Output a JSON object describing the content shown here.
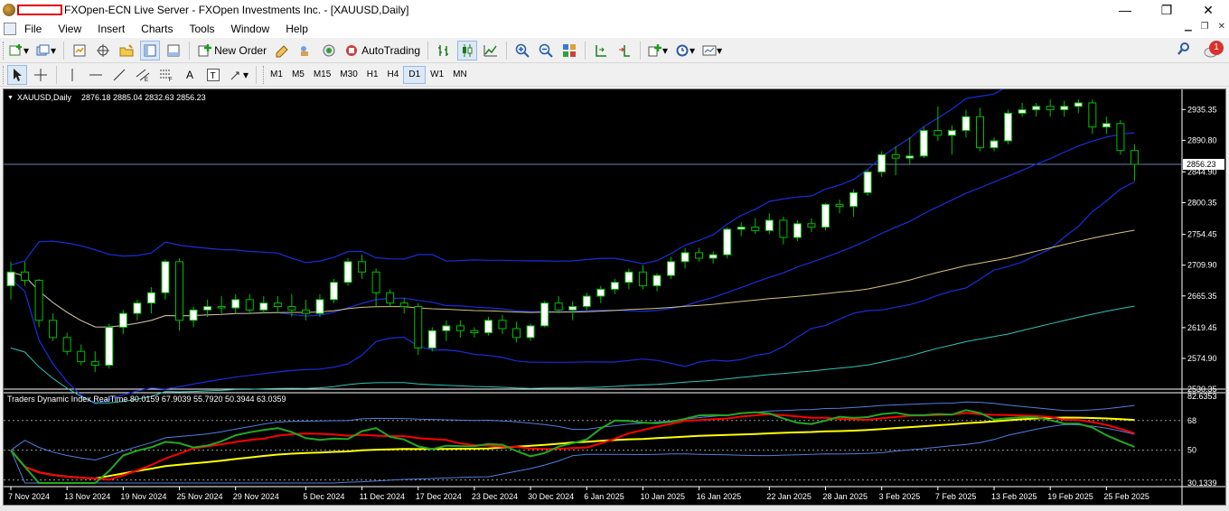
{
  "window": {
    "title": "FXOpen-ECN Live Server - FXOpen Investments Inc. - [XAUUSD,Daily]",
    "controls": {
      "minimize": "—",
      "maximize": "❐",
      "close": "✕"
    }
  },
  "menu": [
    "File",
    "Edit",
    "View",
    "Insert",
    "Charts",
    "Tools",
    "Window",
    "Help"
  ],
  "menu_visible": [
    "File",
    "View",
    "Insert",
    "Charts",
    "Tools",
    "Window",
    "Help"
  ],
  "toolbar": {
    "new_order": "New Order",
    "autotrading": "AutoTrading",
    "notifications_count": "1"
  },
  "timeframes": [
    "M1",
    "M5",
    "M15",
    "M30",
    "H1",
    "H4",
    "D1",
    "W1",
    "MN"
  ],
  "selected_timeframe": "D1",
  "chart": {
    "symbol_label": "XAUUSD,Daily",
    "ohlc_label": "2876.18 2885.04 2832.63 2856.23",
    "current_price_label": "2856.23",
    "price_ticks": [
      "2935.35",
      "2890.80",
      "2844.90",
      "2800.35",
      "2754.45",
      "2709.90",
      "2665.35",
      "2619.45",
      "2574.90",
      "2530.35"
    ],
    "indicator_label": "Traders Dynamic Index RealTime 80.0159 67.9039 55.7920 50.3944 63.0359",
    "indicator_ticks": [
      "82.6353",
      "68",
      "50",
      "30.1339"
    ],
    "date_ticks": [
      "7 Nov 2024",
      "13 Nov 2024",
      "19 Nov 2024",
      "25 Nov 2024",
      "29 Nov 2024",
      "5 Dec 2024",
      "11 Dec 2024",
      "17 Dec 2024",
      "23 Dec 2024",
      "30 Dec 2024",
      "6 Jan 2025",
      "10 Jan 2025",
      "16 Jan 2025",
      "22 Jan 2025",
      "28 Jan 2025",
      "3 Feb 2025",
      "7 Feb 2025",
      "13 Feb 2025",
      "19 Feb 2025",
      "25 Feb 2025"
    ]
  },
  "colors": {
    "background": "#000000",
    "bull_candle": "#ffffff",
    "candle_outline": "#00c000",
    "bollinger": "#1a2ddb",
    "ma_slow": "#d8c27a",
    "ma_teal": "#2ec4b6",
    "price_line": "#6c7fae",
    "tdi_yellow": "#ffff00",
    "tdi_red": "#ff0000",
    "tdi_green": "#22a822",
    "tdi_band": "#4f7fe0"
  },
  "chart_data": {
    "type": "candlestick",
    "ohlc_columns": [
      "open",
      "high",
      "low",
      "close"
    ],
    "candles": [
      [
        2680,
        2715,
        2660,
        2700
      ],
      [
        2700,
        2715,
        2680,
        2688
      ],
      [
        2688,
        2690,
        2620,
        2630
      ],
      [
        2630,
        2640,
        2600,
        2605
      ],
      [
        2605,
        2612,
        2580,
        2585
      ],
      [
        2585,
        2595,
        2565,
        2570
      ],
      [
        2570,
        2585,
        2555,
        2565
      ],
      [
        2565,
        2625,
        2560,
        2620
      ],
      [
        2620,
        2645,
        2610,
        2640
      ],
      [
        2640,
        2660,
        2630,
        2655
      ],
      [
        2655,
        2678,
        2640,
        2670
      ],
      [
        2670,
        2718,
        2660,
        2715
      ],
      [
        2715,
        2720,
        2615,
        2630
      ],
      [
        2630,
        2650,
        2620,
        2645
      ],
      [
        2645,
        2660,
        2635,
        2650
      ],
      [
        2650,
        2665,
        2640,
        2648
      ],
      [
        2648,
        2668,
        2640,
        2660
      ],
      [
        2660,
        2668,
        2640,
        2645
      ],
      [
        2645,
        2665,
        2640,
        2655
      ],
      [
        2655,
        2665,
        2640,
        2650
      ],
      [
        2650,
        2668,
        2635,
        2645
      ],
      [
        2645,
        2660,
        2630,
        2640
      ],
      [
        2640,
        2668,
        2635,
        2660
      ],
      [
        2660,
        2690,
        2655,
        2685
      ],
      [
        2685,
        2720,
        2680,
        2715
      ],
      [
        2715,
        2725,
        2690,
        2700
      ],
      [
        2700,
        2705,
        2650,
        2670
      ],
      [
        2670,
        2675,
        2650,
        2655
      ],
      [
        2655,
        2662,
        2640,
        2650
      ],
      [
        2650,
        2655,
        2580,
        2590
      ],
      [
        2590,
        2620,
        2585,
        2615
      ],
      [
        2615,
        2630,
        2600,
        2622
      ],
      [
        2622,
        2630,
        2605,
        2615
      ],
      [
        2615,
        2620,
        2605,
        2612
      ],
      [
        2612,
        2635,
        2608,
        2630
      ],
      [
        2630,
        2638,
        2610,
        2618
      ],
      [
        2618,
        2628,
        2598,
        2605
      ],
      [
        2605,
        2625,
        2600,
        2622
      ],
      [
        2622,
        2658,
        2620,
        2655
      ],
      [
        2655,
        2665,
        2640,
        2645
      ],
      [
        2645,
        2658,
        2630,
        2650
      ],
      [
        2650,
        2670,
        2645,
        2665
      ],
      [
        2665,
        2680,
        2655,
        2675
      ],
      [
        2675,
        2690,
        2668,
        2685
      ],
      [
        2685,
        2705,
        2675,
        2700
      ],
      [
        2700,
        2710,
        2675,
        2680
      ],
      [
        2680,
        2698,
        2672,
        2695
      ],
      [
        2695,
        2722,
        2690,
        2715
      ],
      [
        2715,
        2735,
        2705,
        2728
      ],
      [
        2728,
        2735,
        2715,
        2720
      ],
      [
        2720,
        2730,
        2712,
        2725
      ],
      [
        2725,
        2765,
        2720,
        2762
      ],
      [
        2762,
        2772,
        2752,
        2765
      ],
      [
        2765,
        2778,
        2755,
        2760
      ],
      [
        2760,
        2785,
        2755,
        2775
      ],
      [
        2775,
        2780,
        2740,
        2750
      ],
      [
        2750,
        2775,
        2745,
        2770
      ],
      [
        2770,
        2778,
        2758,
        2765
      ],
      [
        2765,
        2800,
        2760,
        2798
      ],
      [
        2798,
        2805,
        2785,
        2795
      ],
      [
        2795,
        2820,
        2780,
        2815
      ],
      [
        2815,
        2848,
        2810,
        2845
      ],
      [
        2845,
        2875,
        2838,
        2870
      ],
      [
        2870,
        2882,
        2840,
        2865
      ],
      [
        2865,
        2895,
        2855,
        2868
      ],
      [
        2868,
        2910,
        2865,
        2905
      ],
      [
        2905,
        2940,
        2890,
        2898
      ],
      [
        2898,
        2912,
        2870,
        2905
      ],
      [
        2905,
        2935,
        2895,
        2925
      ],
      [
        2925,
        2938,
        2875,
        2880
      ],
      [
        2880,
        2895,
        2875,
        2890
      ],
      [
        2890,
        2935,
        2885,
        2930
      ],
      [
        2930,
        2945,
        2925,
        2935
      ],
      [
        2935,
        2945,
        2925,
        2940
      ],
      [
        2940,
        2950,
        2925,
        2935
      ],
      [
        2935,
        2948,
        2925,
        2940
      ],
      [
        2940,
        2950,
        2930,
        2945
      ],
      [
        2945,
        2950,
        2900,
        2910
      ],
      [
        2910,
        2925,
        2900,
        2915
      ],
      [
        2915,
        2920,
        2870,
        2876
      ],
      [
        2876,
        2885,
        2832,
        2856
      ]
    ],
    "ylim": [
      2530.35,
      2958
    ],
    "indicator": {
      "name": "Traders Dynamic Index RealTime",
      "values_shown": [
        80.0159,
        67.9039,
        55.792,
        50.3944,
        63.0359
      ],
      "levels": [
        68,
        50,
        32
      ],
      "ylim": [
        30.1339,
        82.6353
      ]
    }
  }
}
